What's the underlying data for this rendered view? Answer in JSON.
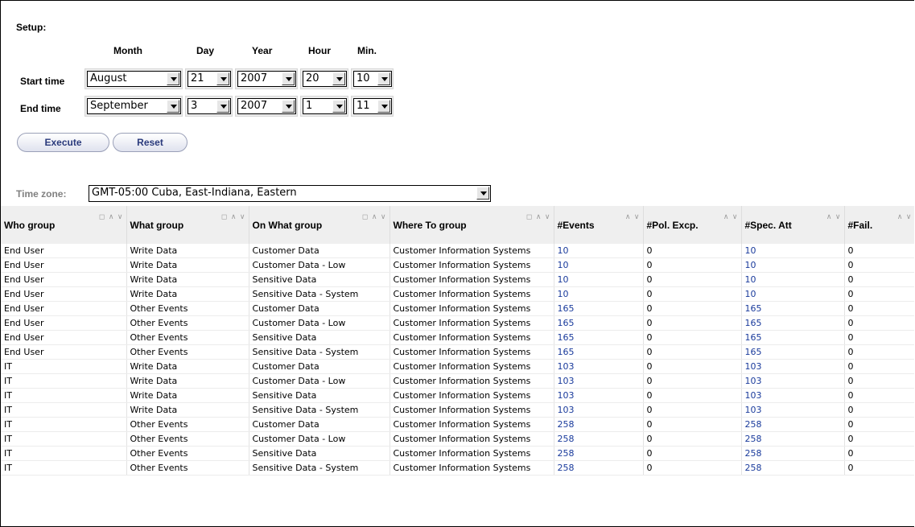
{
  "setup": {
    "title": "Setup:",
    "columns": [
      "Month",
      "Day",
      "Year",
      "Hour",
      "Min."
    ],
    "start": {
      "label": "Start time",
      "month": "August",
      "day": "21",
      "year": "2007",
      "hour": "20",
      "min": "10"
    },
    "end": {
      "label": "End time",
      "month": "September",
      "day": "3",
      "year": "2007",
      "hour": "1",
      "min": "11"
    },
    "execute_label": "Execute",
    "reset_label": "Reset"
  },
  "timezone": {
    "label": "Time zone:",
    "value": "GMT-05:00 Cuba, East-Indiana, Eastern"
  },
  "table": {
    "headers": [
      "Who group",
      "What group",
      "On What group",
      "Where To group",
      "#Events",
      "#Pol. Excp.",
      "#Spec. Att",
      "#Fail."
    ],
    "sort_icons_full": "◻ ∧ ∨",
    "sort_icons_short": "∧ ∨",
    "rows": [
      [
        "End User",
        "Write Data",
        "Customer Data",
        "Customer Information Systems",
        "10",
        "0",
        "10",
        "0"
      ],
      [
        "End User",
        "Write Data",
        "Customer Data - Low",
        "Customer Information Systems",
        "10",
        "0",
        "10",
        "0"
      ],
      [
        "End User",
        "Write Data",
        "Sensitive Data",
        "Customer Information Systems",
        "10",
        "0",
        "10",
        "0"
      ],
      [
        "End User",
        "Write Data",
        "Sensitive Data - System",
        "Customer Information Systems",
        "10",
        "0",
        "10",
        "0"
      ],
      [
        "End User",
        "Other Events",
        "Customer Data",
        "Customer Information Systems",
        "165",
        "0",
        "165",
        "0"
      ],
      [
        "End User",
        "Other Events",
        "Customer Data - Low",
        "Customer Information Systems",
        "165",
        "0",
        "165",
        "0"
      ],
      [
        "End User",
        "Other Events",
        "Sensitive Data",
        "Customer Information Systems",
        "165",
        "0",
        "165",
        "0"
      ],
      [
        "End User",
        "Other Events",
        "Sensitive Data - System",
        "Customer Information Systems",
        "165",
        "0",
        "165",
        "0"
      ],
      [
        "IT",
        "Write Data",
        "Customer Data",
        "Customer Information Systems",
        "103",
        "0",
        "103",
        "0"
      ],
      [
        "IT",
        "Write Data",
        "Customer Data - Low",
        "Customer Information Systems",
        "103",
        "0",
        "103",
        "0"
      ],
      [
        "IT",
        "Write Data",
        "Sensitive Data",
        "Customer Information Systems",
        "103",
        "0",
        "103",
        "0"
      ],
      [
        "IT",
        "Write Data",
        "Sensitive Data - System",
        "Customer Information Systems",
        "103",
        "0",
        "103",
        "0"
      ],
      [
        "IT",
        "Other Events",
        "Customer Data",
        "Customer Information Systems",
        "258",
        "0",
        "258",
        "0"
      ],
      [
        "IT",
        "Other Events",
        "Customer Data - Low",
        "Customer Information Systems",
        "258",
        "0",
        "258",
        "0"
      ],
      [
        "IT",
        "Other Events",
        "Sensitive Data",
        "Customer Information Systems",
        "258",
        "0",
        "258",
        "0"
      ],
      [
        "IT",
        "Other Events",
        "Sensitive Data - System",
        "Customer Information Systems",
        "258",
        "0",
        "258",
        "0"
      ]
    ]
  },
  "colors": {
    "link": "#1a3b9c",
    "header_bg": "#efefef",
    "button_text": "#2a3a7c"
  }
}
